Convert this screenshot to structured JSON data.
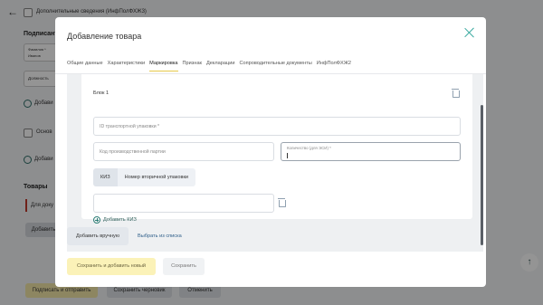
{
  "background": {
    "back_arrow": "←",
    "extra_info": "Дополнительные сведения (ИнфПолФХЖ3)",
    "signer_label": "Подписант",
    "signer_field_1": "Фамилия *",
    "signer_field_1b": "Иванов",
    "signer_field_2": "Должность",
    "add_label_1": "Добави",
    "base_label": "Основ",
    "add_label_2": "Добави",
    "goods_label": "Товары",
    "goods_field": "Для доку",
    "add_btn": "Добавить",
    "footer_btn_1": "Подписать и отправить",
    "footer_btn_2": "Сохранить черновик",
    "footer_btn_3": "Отменить",
    "scroll_top_icon": "↑"
  },
  "modal": {
    "title": "Добавление товара",
    "tabs": [
      {
        "label": "Общие данные"
      },
      {
        "label": "Характеристики"
      },
      {
        "label": "Маркировка"
      },
      {
        "label": "Признак"
      },
      {
        "label": "Декларации"
      },
      {
        "label": "Сопроводительные документы"
      },
      {
        "label": "ИнфПолФХЖ2"
      }
    ],
    "block_title": "Блок 1",
    "transport_placeholder": "ID транспортной упаковки *",
    "batch_placeholder": "Код производственной партии",
    "qty_label": "Количество (для ЭСИ) *",
    "segment": {
      "kiz": "КИЗ",
      "secondary": "Номер вторичной упаковки"
    },
    "add_kiz": "Добавить КИЗ",
    "add_manual": "Добавить вручную",
    "choose_list": "Выбрать из списка",
    "save_add_new": "Сохранить и добавить новый",
    "save": "Сохранить"
  }
}
